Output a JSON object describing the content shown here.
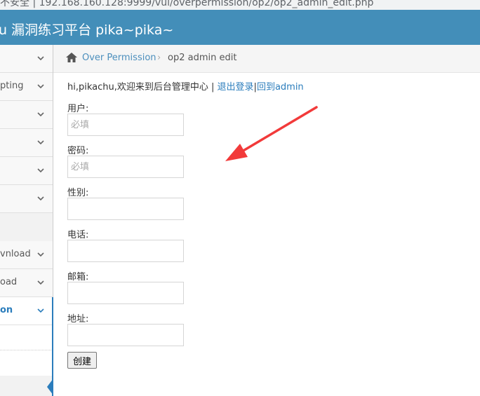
{
  "browser": {
    "url_text": "不安全 | 192.168.160.128:9999/vul/overpermission/op2/op2_admin_edit.php"
  },
  "header": {
    "brand": "u 漏洞练习平台 pika~pika~"
  },
  "sidebar": {
    "items": [
      {
        "label": ""
      },
      {
        "label": "pting"
      },
      {
        "label": ""
      },
      {
        "label": ""
      },
      {
        "label": ""
      },
      {
        "label": ""
      },
      {
        "label": "vnload"
      },
      {
        "label": "oad"
      },
      {
        "label": "on"
      }
    ]
  },
  "breadcrumb": {
    "parent": "Over Permission",
    "separator": "›",
    "current": "op2 admin edit"
  },
  "welcome": {
    "text": "hi,pikachu,欢迎来到后台管理中心 | ",
    "logout": "退出登录",
    "sep": "|",
    "back": "回到admin"
  },
  "form": {
    "fields": [
      {
        "label": "用户:",
        "placeholder": "必填"
      },
      {
        "label": "密码:",
        "placeholder": "必填"
      },
      {
        "label": "性别:",
        "placeholder": ""
      },
      {
        "label": "电话:",
        "placeholder": ""
      },
      {
        "label": "邮箱:",
        "placeholder": ""
      },
      {
        "label": "地址:",
        "placeholder": ""
      }
    ],
    "submit": "创建"
  },
  "colors": {
    "navbar": "#438eb9",
    "link": "#2b7dbc",
    "annotation_arrow": "#f23a3a"
  },
  "icons": {
    "home": "home-icon",
    "chevron": "chevron-down-icon"
  }
}
